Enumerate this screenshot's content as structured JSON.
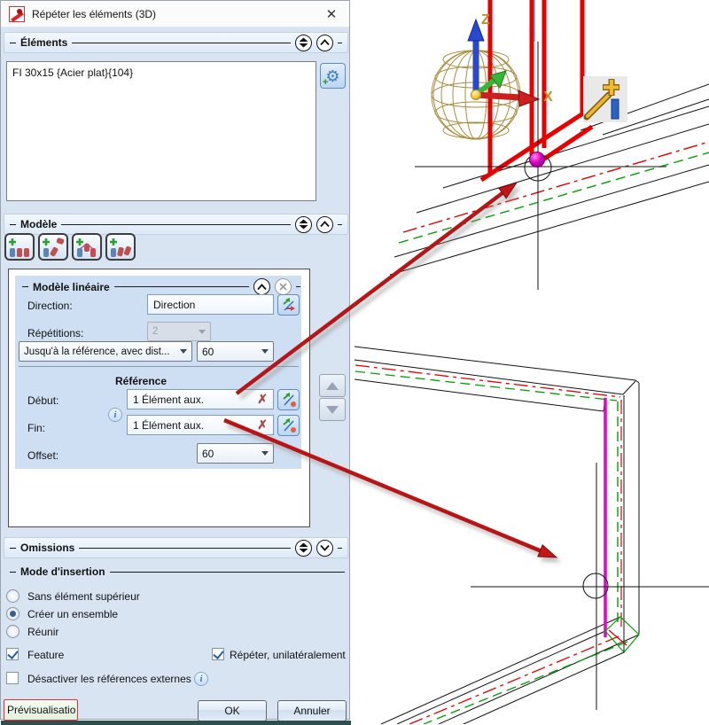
{
  "window": {
    "title": "Répéter les éléments (3D)",
    "close_glyph": "✕"
  },
  "glyphs": {
    "clear": "✗",
    "info": "i",
    "gear": "⚙"
  },
  "sections": {
    "elements": {
      "title": "Éléments",
      "list_item": "FI 30x15 {Acier plat}{104}"
    },
    "model": {
      "title": "Modèle",
      "linear": {
        "title": "Modèle linéaire",
        "direction_label": "Direction:",
        "direction_value": "Direction",
        "repetitions_label": "Répétitions:",
        "repetitions_value": "2",
        "until_reference_value": "Jusqu'à la référence, avec dist...",
        "distance_value": "60",
        "reference_label": "Référence",
        "start_label": "Début:",
        "start_value": "1 Élément aux.",
        "end_label": "Fin:",
        "end_value": "1 Élément aux.",
        "offset_label": "Offset:",
        "offset_value": "60"
      }
    },
    "omissions": {
      "title": "Omissions"
    },
    "insertion": {
      "title": "Mode d'insertion",
      "radios": [
        {
          "label": "Sans élément supérieur",
          "selected": false
        },
        {
          "label": "Créer un ensemble",
          "selected": true
        },
        {
          "label": "Réunir",
          "selected": false
        }
      ],
      "checkboxes": [
        {
          "label": "Feature",
          "checked": true
        },
        {
          "label": "Répéter, unilatéralement",
          "checked": true
        },
        {
          "label": "Désactiver les références externes",
          "checked": false
        }
      ]
    }
  },
  "footer": {
    "preview_label": "Prévisualisatio",
    "ok_label": "OK",
    "cancel_label": "Annuler"
  },
  "viewport": {
    "axis_z": "Z",
    "axis_x": "X"
  },
  "colors": {
    "dialog_bg": "#d9e4f3",
    "group_bg": "#cfdff3",
    "annotation_arrow": "#b81414",
    "preview_red": "#e80000",
    "reference_magenta": "#e800cc",
    "axis_x_red": "#cc2020",
    "axis_z_blue": "#2a48cc",
    "axis_y_green": "#36b836",
    "sphere_gold": "#a98d3e",
    "centerline_red": "#e00000",
    "centerline_green": "#00a000",
    "aux_cyan": "#3cb4dc"
  }
}
